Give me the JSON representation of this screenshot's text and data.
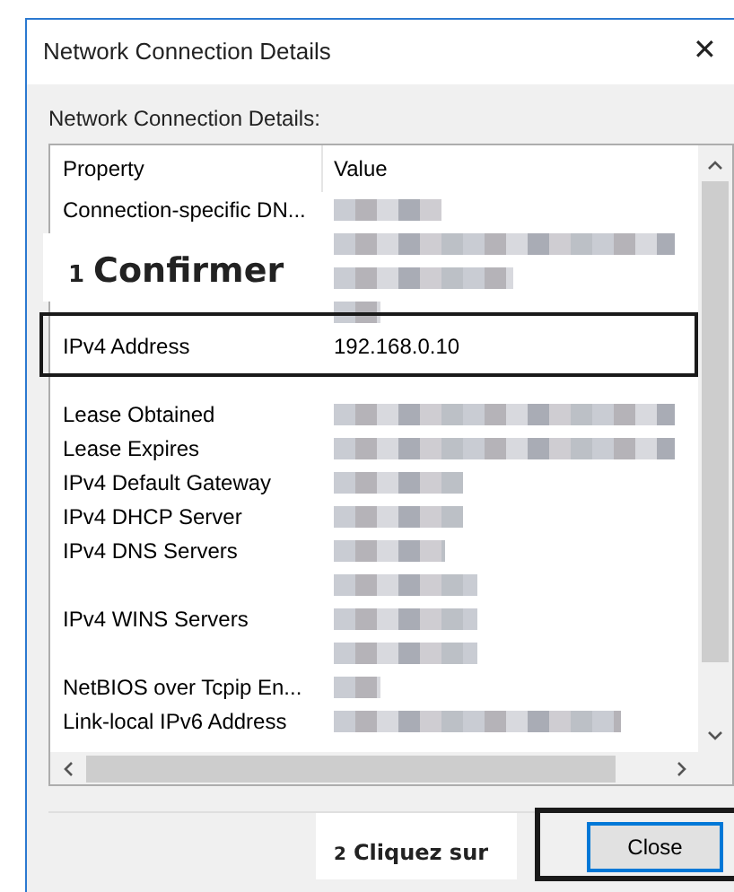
{
  "window": {
    "title": "Network Connection Details",
    "close_glyph": "✕"
  },
  "label": "Network Connection Details:",
  "table": {
    "columns": [
      "Property",
      "Value"
    ],
    "rows": [
      {
        "property": "Connection-specific DN...",
        "kind": "redacted"
      },
      {
        "kind": "redacted"
      },
      {
        "kind": "redacted"
      },
      {
        "kind": "redacted"
      },
      {
        "property": "IPv4 Address",
        "kind": "text",
        "value": "192.168.0.10"
      },
      {
        "kind": "blank"
      },
      {
        "property": "Lease Obtained",
        "kind": "redacted"
      },
      {
        "property": "Lease Expires",
        "kind": "redacted"
      },
      {
        "property": "IPv4 Default Gateway",
        "kind": "redacted"
      },
      {
        "property": "IPv4 DHCP Server",
        "kind": "redacted"
      },
      {
        "property": "IPv4 DNS Servers",
        "kind": "redacted"
      },
      {
        "kind": "redacted"
      },
      {
        "property": "IPv4 WINS Servers",
        "kind": "redacted"
      },
      {
        "kind": "redacted"
      },
      {
        "property": "NetBIOS over Tcpip En...",
        "kind": "redacted"
      },
      {
        "property": "Link-local IPv6 Address",
        "kind": "redacted"
      },
      {
        "kind": "blank"
      }
    ]
  },
  "buttons": [
    {
      "label": "Close",
      "default": true
    }
  ],
  "annotations": [
    {
      "number": "1",
      "text": "Confirmer"
    },
    {
      "number": "2",
      "text": "Cliquez sur"
    }
  ]
}
